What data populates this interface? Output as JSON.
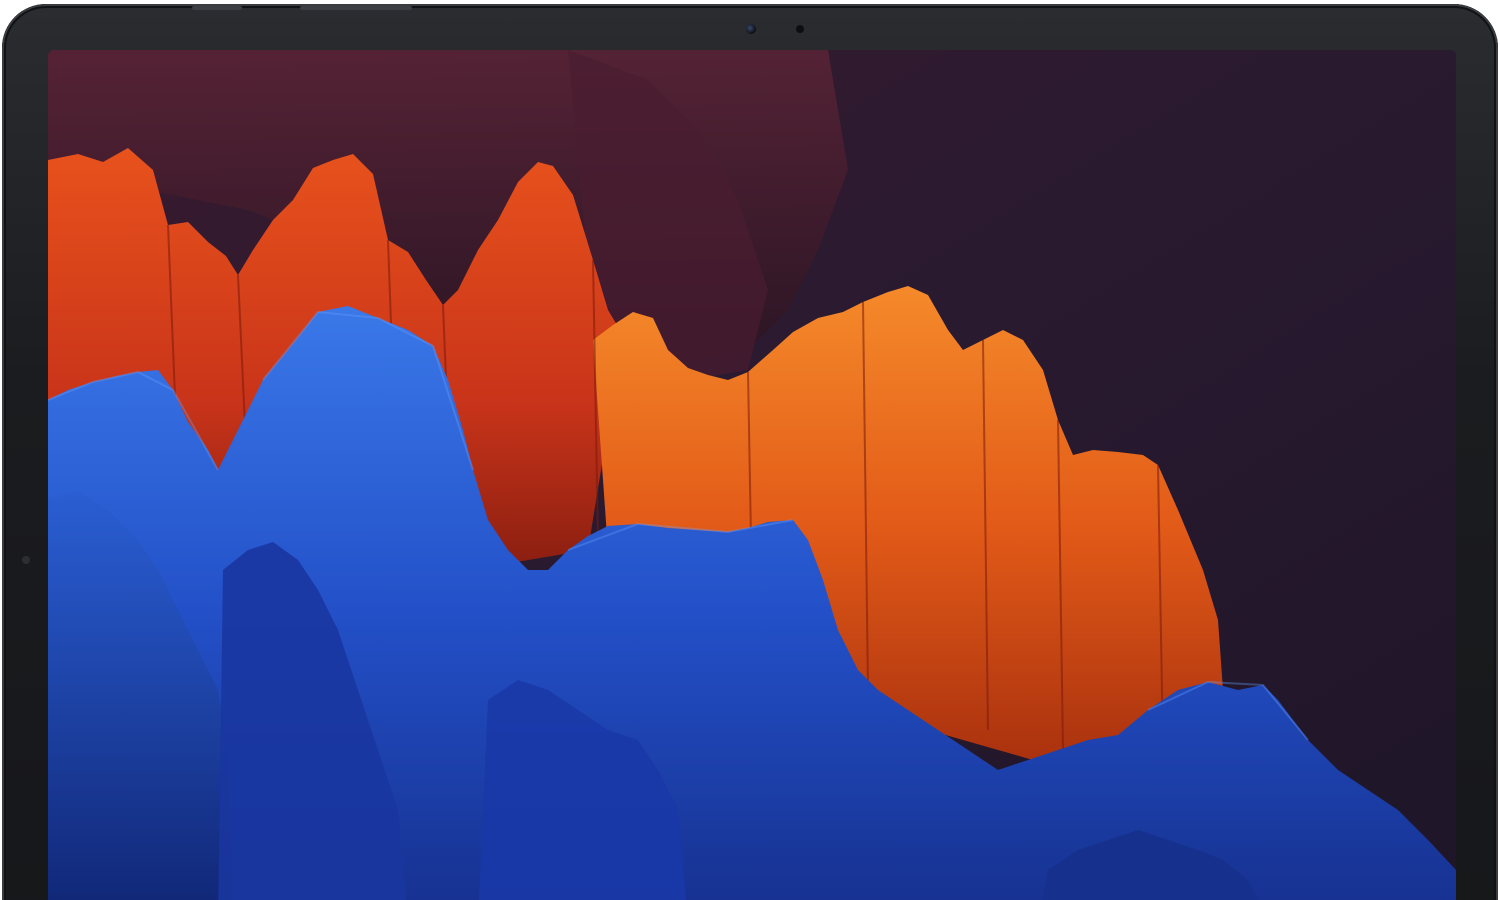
{
  "device": {
    "kind": "tablet",
    "frame_color": "#1b1c1f"
  },
  "wallpaper": {
    "background_color": "#1f1624",
    "palette": {
      "deep_plum": "#3a1a2e",
      "dark_violet": "#1e1528",
      "red_orange": "#e0461c",
      "orange": "#f06a1a",
      "burnt_orange": "#b8380f",
      "bright_blue": "#2a62d6",
      "royal_blue": "#1f3fb8",
      "navy_blue": "#142a86"
    }
  }
}
